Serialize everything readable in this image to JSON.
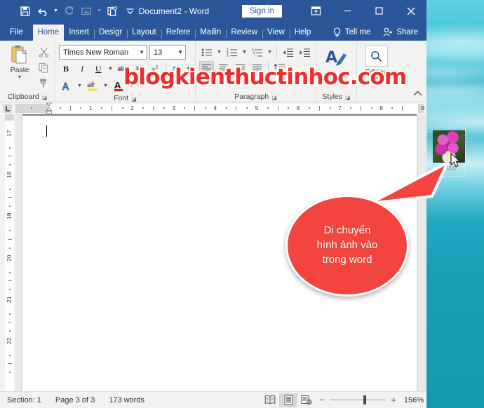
{
  "desktop": {
    "icon": {
      "label": "hình",
      "name": "image-file"
    },
    "wallpaper_color": "#1498b1"
  },
  "window": {
    "title": "Document2  -  Word",
    "quick_access": [
      {
        "name": "save-icon",
        "label": "Save",
        "enabled": true
      },
      {
        "name": "undo-icon",
        "label": "Undo",
        "enabled": true
      },
      {
        "name": "redo-icon",
        "label": "Redo",
        "enabled": false
      },
      {
        "name": "touch-mode-icon",
        "label": "Touch/Mouse Mode",
        "enabled": false
      },
      {
        "name": "copy-format-icon",
        "label": "Format Painter",
        "enabled": true
      },
      {
        "name": "customize-qat-icon",
        "label": "Customize Quick Access Toolbar",
        "enabled": true
      }
    ],
    "sign_in": "Sign in",
    "controls": {
      "ribbon_display": "Ribbon Display Options",
      "minimize": "Minimize",
      "maximize": "Maximize",
      "close": "Close"
    }
  },
  "tabs": {
    "items": [
      {
        "label": "File",
        "active": false
      },
      {
        "label": "Home",
        "active": true
      },
      {
        "label": "Insert",
        "active": false
      },
      {
        "label": "Desigr",
        "active": false
      },
      {
        "label": "Layout",
        "active": false
      },
      {
        "label": "Refere",
        "active": false
      },
      {
        "label": "Mailin",
        "active": false
      },
      {
        "label": "Review",
        "active": false
      },
      {
        "label": "View",
        "active": false
      },
      {
        "label": "Help",
        "active": false
      }
    ],
    "tell_me": "Tell me",
    "share": "Share"
  },
  "ribbon": {
    "clipboard": {
      "label": "Clipboard",
      "paste": "Paste",
      "cut": "Cut",
      "copy": "Copy",
      "format_painter": "Format Painter"
    },
    "font": {
      "label": "Font",
      "font_name": "Times New Roman",
      "font_size": "13",
      "bold": "B",
      "italic": "I",
      "underline": "U",
      "strikethrough": "abc",
      "subscript": "X₂",
      "superscript": "X²",
      "text_effects": "A",
      "highlight": "ab",
      "font_color": "A"
    },
    "paragraph": {
      "label": "Paragraph",
      "bullets": "Bullets",
      "numbering": "Numbering",
      "multilevel": "Multilevel List",
      "decrease_indent": "Decrease Indent",
      "increase_indent": "Increase Indent",
      "align_left": "Align Left",
      "center": "Center",
      "align_right": "Align Right",
      "justify": "Justify",
      "line_spacing": "Line and Paragraph Spacing"
    },
    "styles": {
      "label": "Styles"
    },
    "editing": {
      "label": "Editing",
      "find": "Find"
    },
    "collapse": "Collapse the Ribbon"
  },
  "rulers": {
    "horizontal": [
      "1",
      "2",
      "3",
      "4",
      "5",
      "6",
      "7",
      "8",
      "9"
    ],
    "vertical": [
      "17",
      "18",
      "19",
      "20",
      "21",
      "22"
    ],
    "tab_selector": "L"
  },
  "status_bar": {
    "section": "Section: 1",
    "page": "Page 3 of 3",
    "words": "173 words",
    "views": [
      {
        "name": "read-mode-icon",
        "label": "Read Mode",
        "selected": false
      },
      {
        "name": "print-layout-icon",
        "label": "Print Layout",
        "selected": true
      },
      {
        "name": "web-layout-icon",
        "label": "Web Layout",
        "selected": false
      }
    ],
    "zoom_out": "−",
    "zoom_in": "+",
    "zoom_level": "156%"
  },
  "watermark": {
    "text": "blogkienthuctinhoc.com",
    "color": "#ef2d2d"
  },
  "callout": {
    "line1": "Di chuyển",
    "line2": "hình ảnh vào",
    "line3": "trong word",
    "color": "#f4443f"
  }
}
